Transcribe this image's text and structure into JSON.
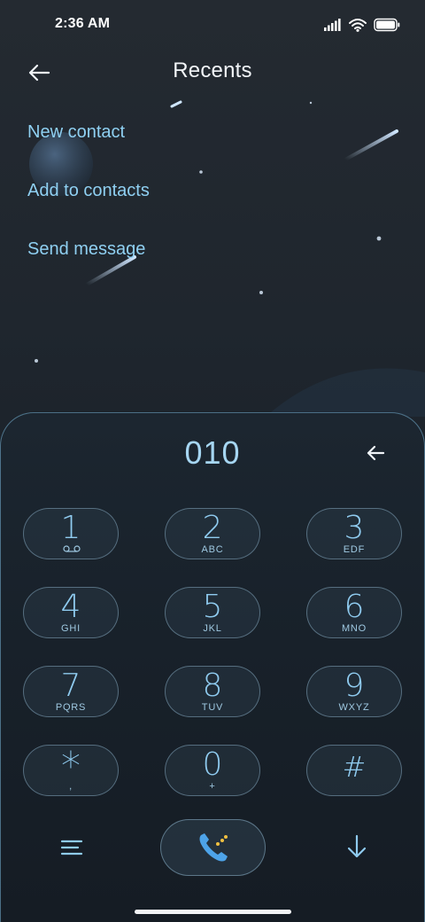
{
  "status_bar": {
    "time": "2:36 AM"
  },
  "header": {
    "title": "Recents"
  },
  "actions": [
    {
      "label": "New contact"
    },
    {
      "label": "Add to contacts"
    },
    {
      "label": "Send message"
    }
  ],
  "dialer": {
    "number": "010"
  },
  "keypad": [
    {
      "digit": "1",
      "letters": ""
    },
    {
      "digit": "2",
      "letters": "ABC"
    },
    {
      "digit": "3",
      "letters": "EDF"
    },
    {
      "digit": "4",
      "letters": "GHI"
    },
    {
      "digit": "5",
      "letters": "JKL"
    },
    {
      "digit": "6",
      "letters": "MNO"
    },
    {
      "digit": "7",
      "letters": "PQRS"
    },
    {
      "digit": "8",
      "letters": "TUV"
    },
    {
      "digit": "9",
      "letters": "WXYZ"
    },
    {
      "digit": "*",
      "letters": ","
    },
    {
      "digit": "0",
      "letters": "+"
    },
    {
      "digit": "#",
      "letters": ""
    }
  ],
  "icons": {
    "back": "back-arrow-icon",
    "backspace": "backspace-icon",
    "voicemail": "voicemail-icon",
    "menu": "menu-icon",
    "call": "phone-call-icon",
    "collapse": "arrow-down-icon",
    "signal": "signal-icon",
    "wifi": "wifi-icon",
    "battery": "battery-icon"
  },
  "colors": {
    "accent": "#8fd0f2",
    "call_icon": "#4da3e8",
    "call_dots": "#f0c040"
  }
}
